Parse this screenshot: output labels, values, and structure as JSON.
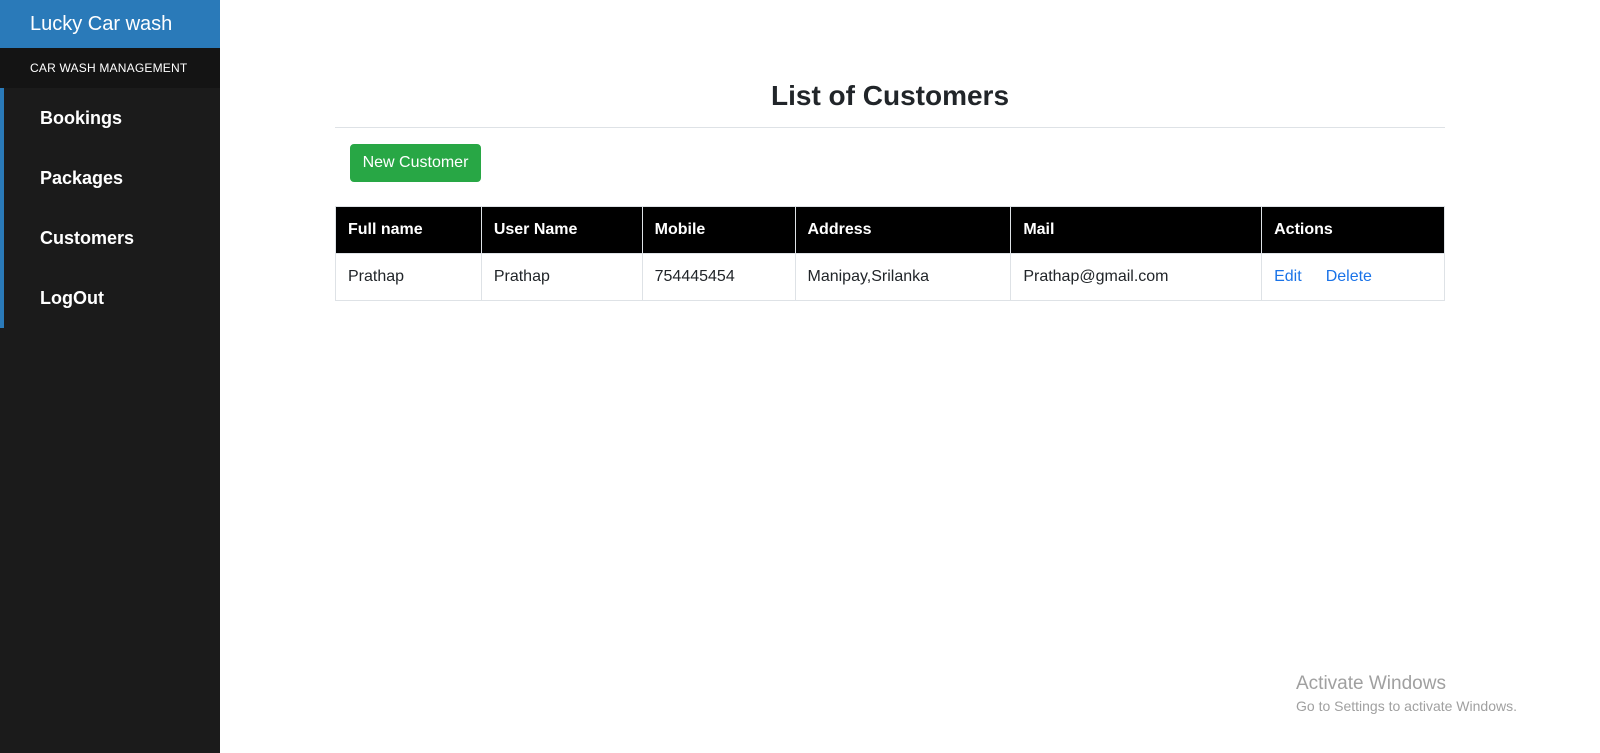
{
  "sidebar": {
    "brand": "Lucky Car wash",
    "subtitle": "CAR WASH MANAGEMENT",
    "items": [
      {
        "label": "Bookings"
      },
      {
        "label": "Packages"
      },
      {
        "label": "Customers"
      },
      {
        "label": "LogOut"
      }
    ]
  },
  "main": {
    "title": "List of Customers",
    "new_button_label": "New Customer",
    "table": {
      "headers": [
        "Full name",
        "User Name",
        "Mobile",
        "Address",
        "Mail",
        "Actions"
      ],
      "rows": [
        {
          "full_name": "Prathap",
          "user_name": "Prathap",
          "mobile": "754445454",
          "address": "Manipay,Srilanka",
          "mail": "Prathap@gmail.com",
          "edit_label": "Edit",
          "delete_label": "Delete"
        }
      ]
    }
  },
  "watermark": {
    "title": "Activate Windows",
    "subtitle": "Go to Settings to activate Windows."
  },
  "colors": {
    "brand": "#2a7ab9",
    "sidebar_bg": "#1b1b1b",
    "success": "#28a745",
    "link": "#1a73e8",
    "table_header_bg": "#000000"
  }
}
